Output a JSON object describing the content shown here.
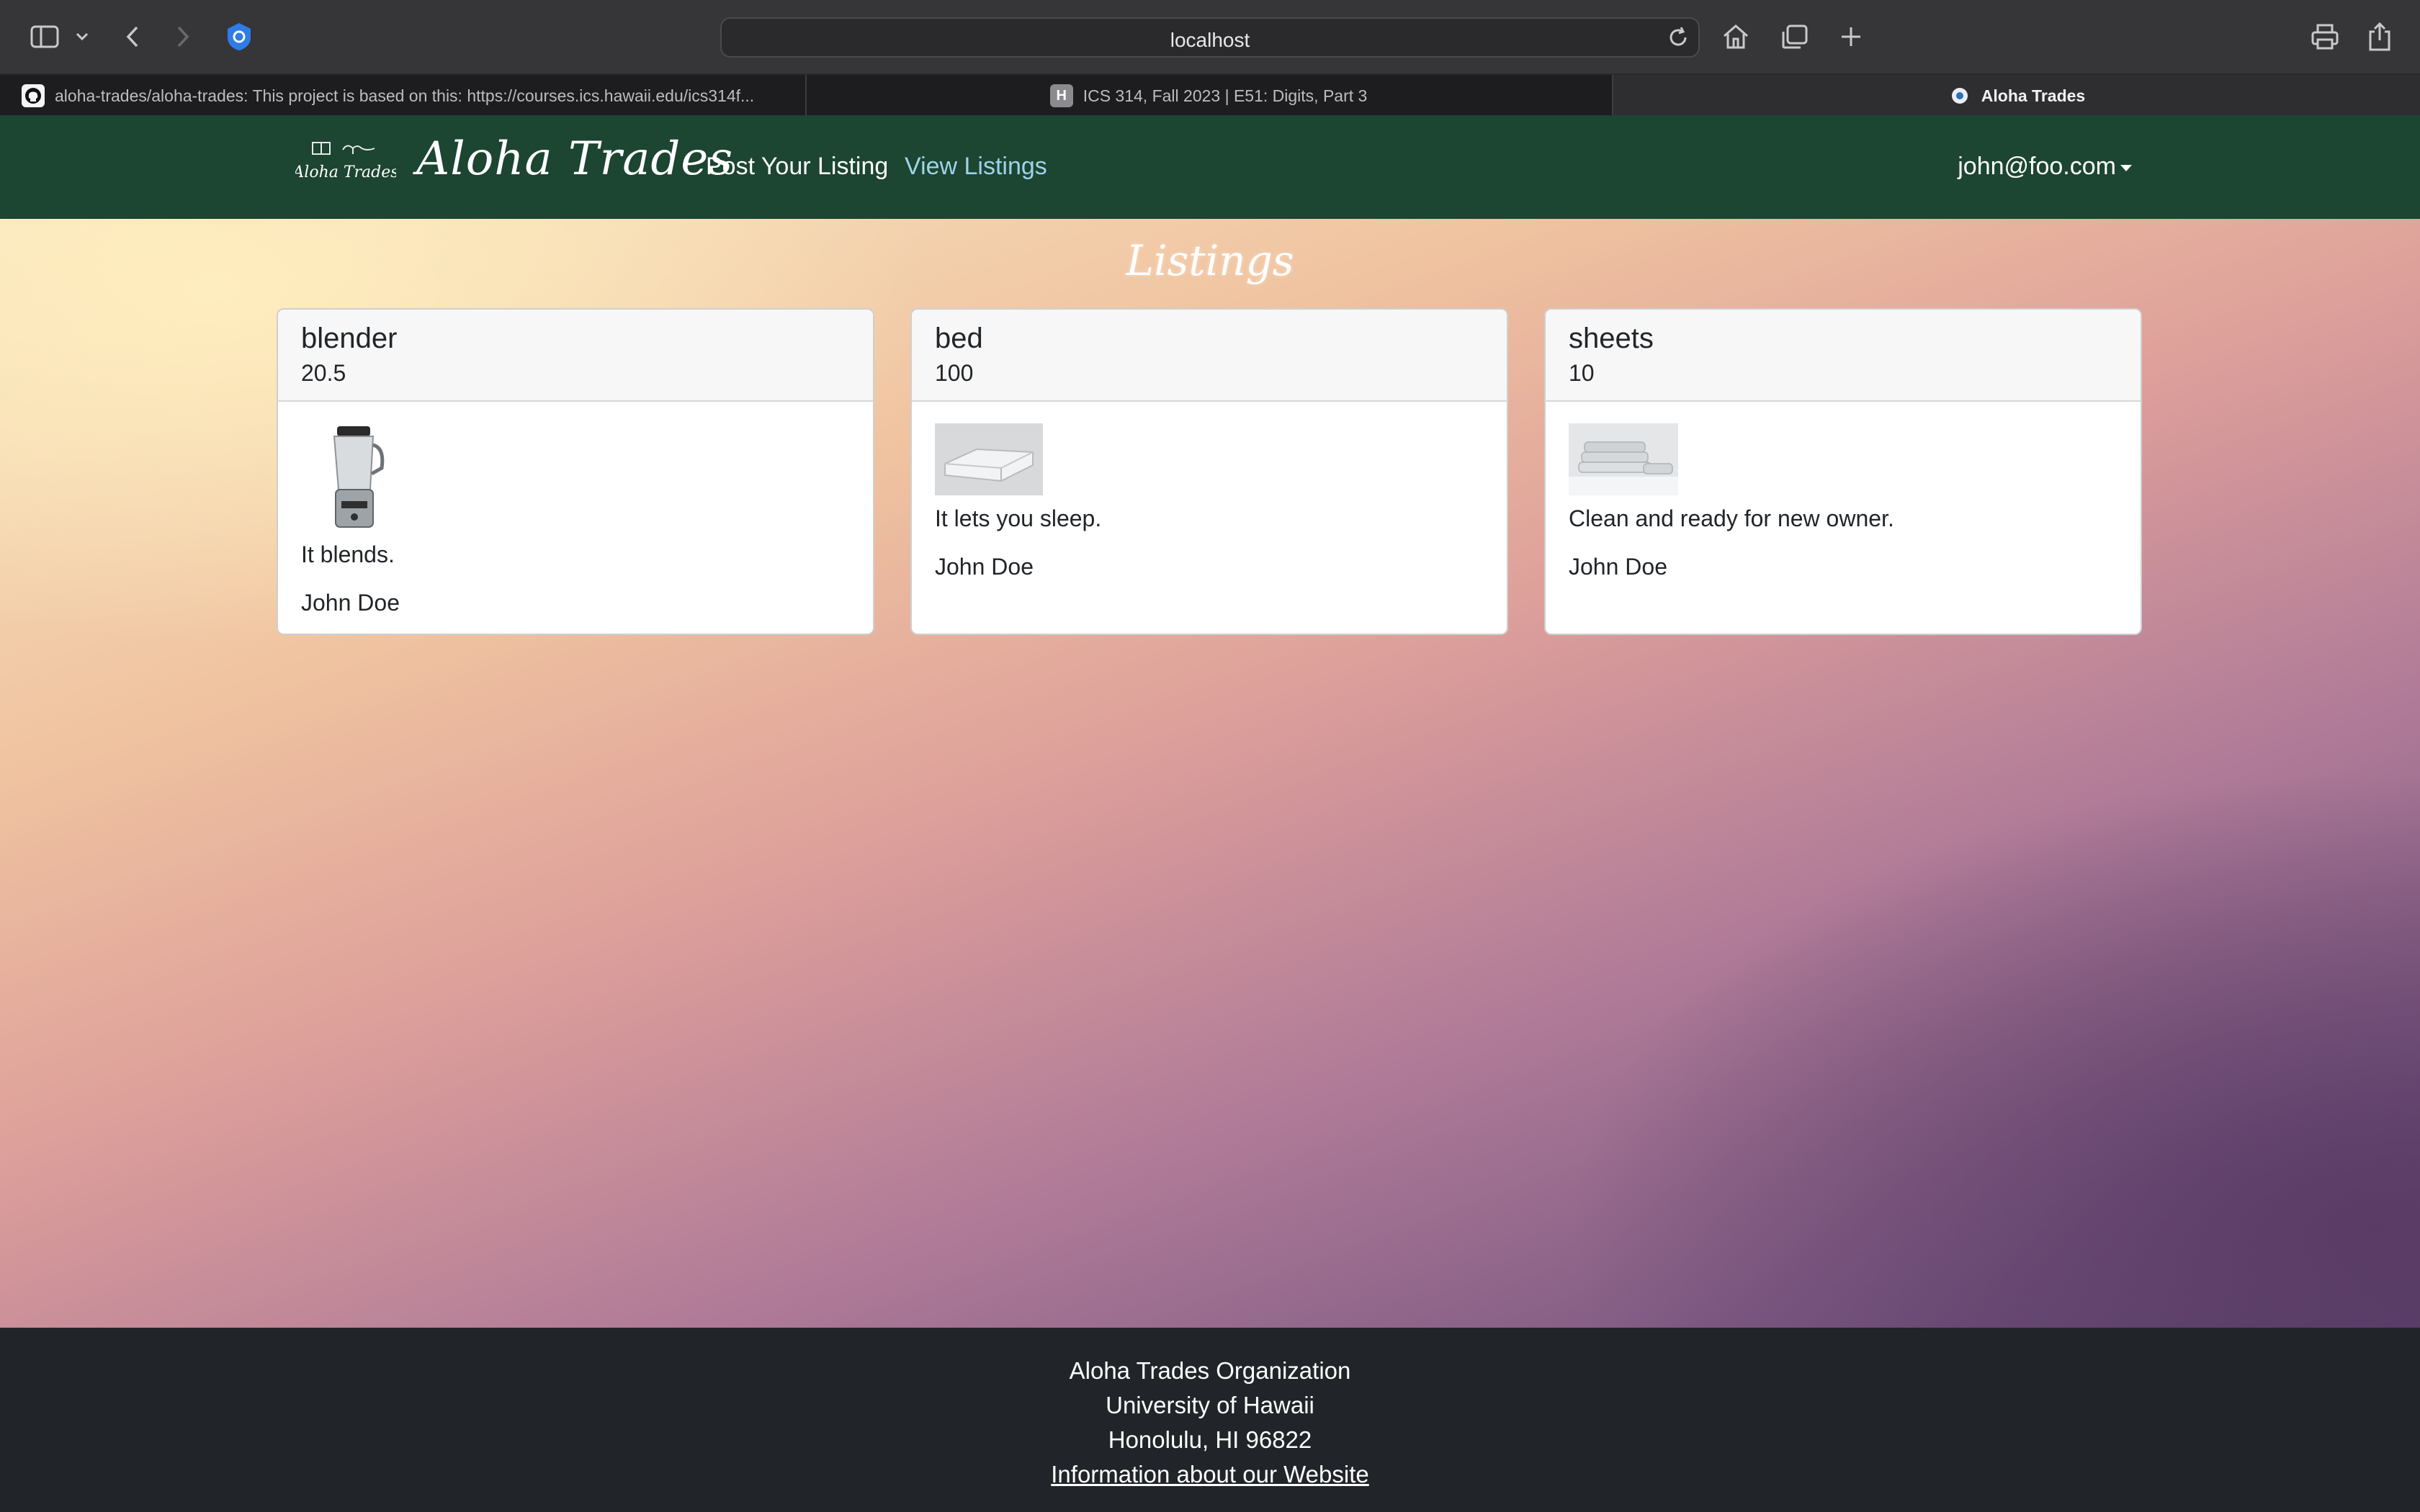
{
  "browser": {
    "url": "localhost",
    "tabs": [
      {
        "label": "aloha-trades/aloha-trades: This project is based on this: https://courses.ics.hawaii.edu/ics314f...",
        "icon": "github-icon"
      },
      {
        "label": "ICS 314, Fall 2023 | E51: Digits, Part 3",
        "icon": "h-icon"
      },
      {
        "label": "Aloha Trades",
        "icon": "aloha-trades-icon"
      }
    ]
  },
  "navbar": {
    "logo_text": "Aloha Trades",
    "brand": "Aloha Trades",
    "links": [
      "Post Your Listing",
      "View Listings"
    ],
    "user": "john@foo.com"
  },
  "main": {
    "title": "Listings",
    "listings": [
      {
        "name": "blender",
        "price": "20.5",
        "description": "It blends.",
        "owner": "John Doe",
        "image": "blender-image"
      },
      {
        "name": "bed",
        "price": "100",
        "description": "It lets you sleep.",
        "owner": "John Doe",
        "image": "mattress-image"
      },
      {
        "name": "sheets",
        "price": "10",
        "description": "Clean and ready for new owner.",
        "owner": "John Doe",
        "image": "folded-sheets-image"
      }
    ]
  },
  "footer": {
    "lines": [
      "Aloha Trades Organization",
      "University of Hawaii",
      "Honolulu, HI 96822"
    ],
    "link": "Information about our Website"
  },
  "colors": {
    "navbar": "#1c4532",
    "footer": "#212529",
    "active_link": "#9fd3e8"
  }
}
